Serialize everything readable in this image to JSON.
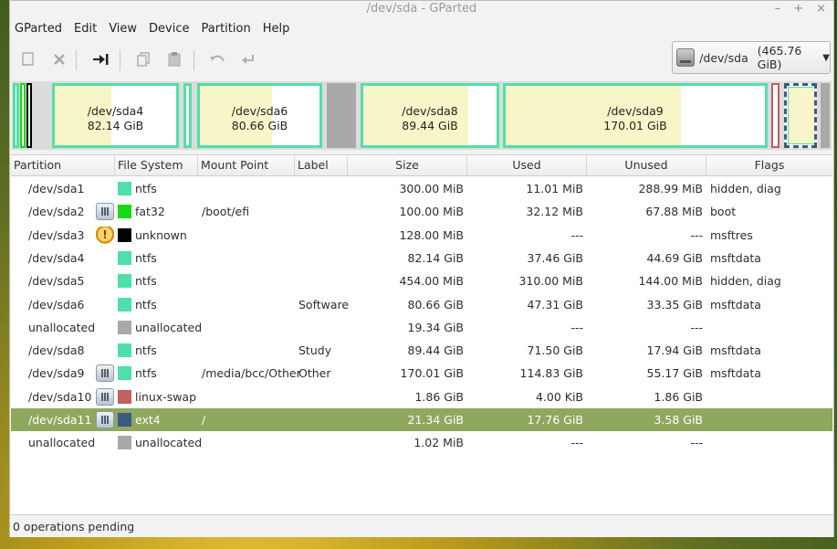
{
  "window": {
    "title": "/dev/sda - GParted",
    "min_glyph": "–",
    "max_glyph": "+",
    "close_glyph": "×"
  },
  "menu": [
    "GParted",
    "Edit",
    "View",
    "Device",
    "Partition",
    "Help"
  ],
  "device": {
    "name": "/dev/sda",
    "size": "(465.76 GiB)",
    "icon": "hard-disk-icon"
  },
  "graph_segments": [
    {
      "name": "/dev/sda4",
      "size": "82.14 GiB"
    },
    {
      "name": "/dev/sda6",
      "size": "80.66 GiB"
    },
    {
      "name": "/dev/sda8",
      "size": "89.44 GiB"
    },
    {
      "name": "/dev/sda9",
      "size": "170.01 GiB"
    }
  ],
  "columns": [
    "Partition",
    "File System",
    "Mount Point",
    "Label",
    "Size",
    "Used",
    "Unused",
    "Flags"
  ],
  "rows": [
    {
      "partition": "/dev/sda1",
      "icon": "",
      "fs": "ntfs",
      "fs_color": "#4ee0a8",
      "mount": "",
      "label": "",
      "size": "300.00 MiB",
      "used": "11.01 MiB",
      "unused": "288.99 MiB",
      "flags": "hidden, diag"
    },
    {
      "partition": "/dev/sda2",
      "icon": "lock",
      "fs": "fat32",
      "fs_color": "#18d818",
      "mount": "/boot/efi",
      "label": "",
      "size": "100.00 MiB",
      "used": "32.12 MiB",
      "unused": "67.88 MiB",
      "flags": "boot"
    },
    {
      "partition": "/dev/sda3",
      "icon": "warn",
      "fs": "unknown",
      "fs_color": "#000000",
      "mount": "",
      "label": "",
      "size": "128.00 MiB",
      "used": "---",
      "unused": "---",
      "flags": "msftres"
    },
    {
      "partition": "/dev/sda4",
      "icon": "",
      "fs": "ntfs",
      "fs_color": "#4ee0a8",
      "mount": "",
      "label": "",
      "size": "82.14 GiB",
      "used": "37.46 GiB",
      "unused": "44.69 GiB",
      "flags": "msftdata"
    },
    {
      "partition": "/dev/sda5",
      "icon": "",
      "fs": "ntfs",
      "fs_color": "#4ee0a8",
      "mount": "",
      "label": "",
      "size": "454.00 MiB",
      "used": "310.00 MiB",
      "unused": "144.00 MiB",
      "flags": "hidden, diag"
    },
    {
      "partition": "/dev/sda6",
      "icon": "",
      "fs": "ntfs",
      "fs_color": "#4ee0a8",
      "mount": "",
      "label": "Software",
      "size": "80.66 GiB",
      "used": "47.31 GiB",
      "unused": "33.35 GiB",
      "flags": "msftdata"
    },
    {
      "partition": "unallocated",
      "icon": "",
      "fs": "unallocated",
      "fs_color": "#a9a9a9",
      "mount": "",
      "label": "",
      "size": "19.34 GiB",
      "used": "---",
      "unused": "---",
      "flags": ""
    },
    {
      "partition": "/dev/sda8",
      "icon": "",
      "fs": "ntfs",
      "fs_color": "#4ee0a8",
      "mount": "",
      "label": "Study",
      "size": "89.44 GiB",
      "used": "71.50 GiB",
      "unused": "17.94 GiB",
      "flags": "msftdata"
    },
    {
      "partition": "/dev/sda9",
      "icon": "lock",
      "fs": "ntfs",
      "fs_color": "#4ee0a8",
      "mount": "/media/bcc/Other",
      "label": "Other",
      "size": "170.01 GiB",
      "used": "114.83 GiB",
      "unused": "55.17 GiB",
      "flags": "msftdata"
    },
    {
      "partition": "/dev/sda10",
      "icon": "lock",
      "fs": "linux-swap",
      "fs_color": "#c06060",
      "mount": "",
      "label": "",
      "size": "1.86 GiB",
      "used": "4.00 KiB",
      "unused": "1.86 GiB",
      "flags": ""
    },
    {
      "partition": "/dev/sda11",
      "icon": "lock",
      "fs": "ext4",
      "fs_color": "#3d5a80",
      "mount": "/",
      "label": "",
      "size": "21.34 GiB",
      "used": "17.76 GiB",
      "unused": "3.58 GiB",
      "flags": "",
      "selected": true
    },
    {
      "partition": "unallocated",
      "icon": "",
      "fs": "unallocated",
      "fs_color": "#a9a9a9",
      "mount": "",
      "label": "",
      "size": "1.02 MiB",
      "used": "---",
      "unused": "---",
      "flags": ""
    }
  ],
  "status": "0 operations pending"
}
